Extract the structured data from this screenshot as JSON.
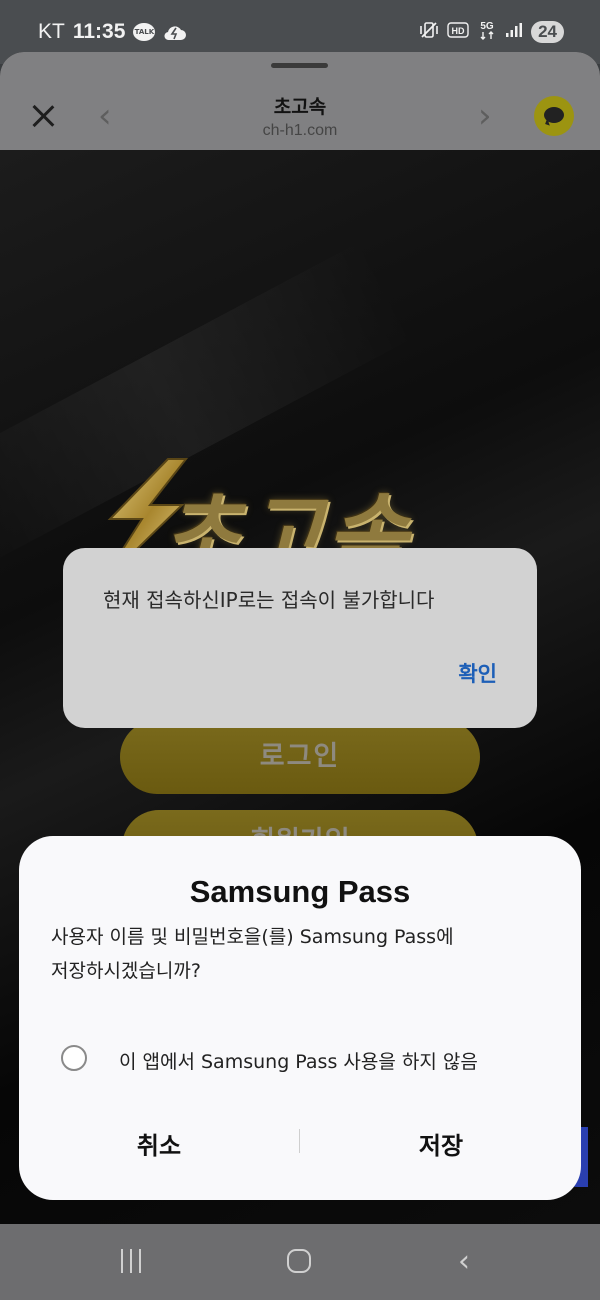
{
  "status_bar": {
    "carrier": "KT",
    "time": "11:35",
    "talk_badge": "TALK",
    "battery": "24",
    "icons": [
      "kakaotalk-icon",
      "cloud-icon",
      "vibrate-off-icon",
      "hd-icon",
      "5g-icon",
      "signal-icon",
      "battery-icon"
    ]
  },
  "browser": {
    "title": "초고속",
    "url": "ch-h1.com",
    "back_glyph": "‹",
    "forward_glyph": "›"
  },
  "page": {
    "logo_text": "초고속",
    "login_button": "로그인",
    "signup_button": "회원가입"
  },
  "alert": {
    "message": "현재 접속하신IP로는 접속이 불가합니다",
    "confirm": "확인"
  },
  "samsung_pass": {
    "title": "Samsung Pass",
    "message_line1": "사용자 이름 및 비밀번호을(를) Samsung Pass에",
    "message_line2": "저장하시겠습니까?",
    "option": "이 앱에서 Samsung Pass 사용을 하지 않음",
    "option_checked": false,
    "cancel": "취소",
    "save": "저장"
  },
  "nav_bar": {
    "back_glyph": "‹"
  },
  "colors": {
    "accent_blue": "#1d5fb7",
    "gold": "#8f7a3e",
    "chat_button": "#9c9411"
  }
}
